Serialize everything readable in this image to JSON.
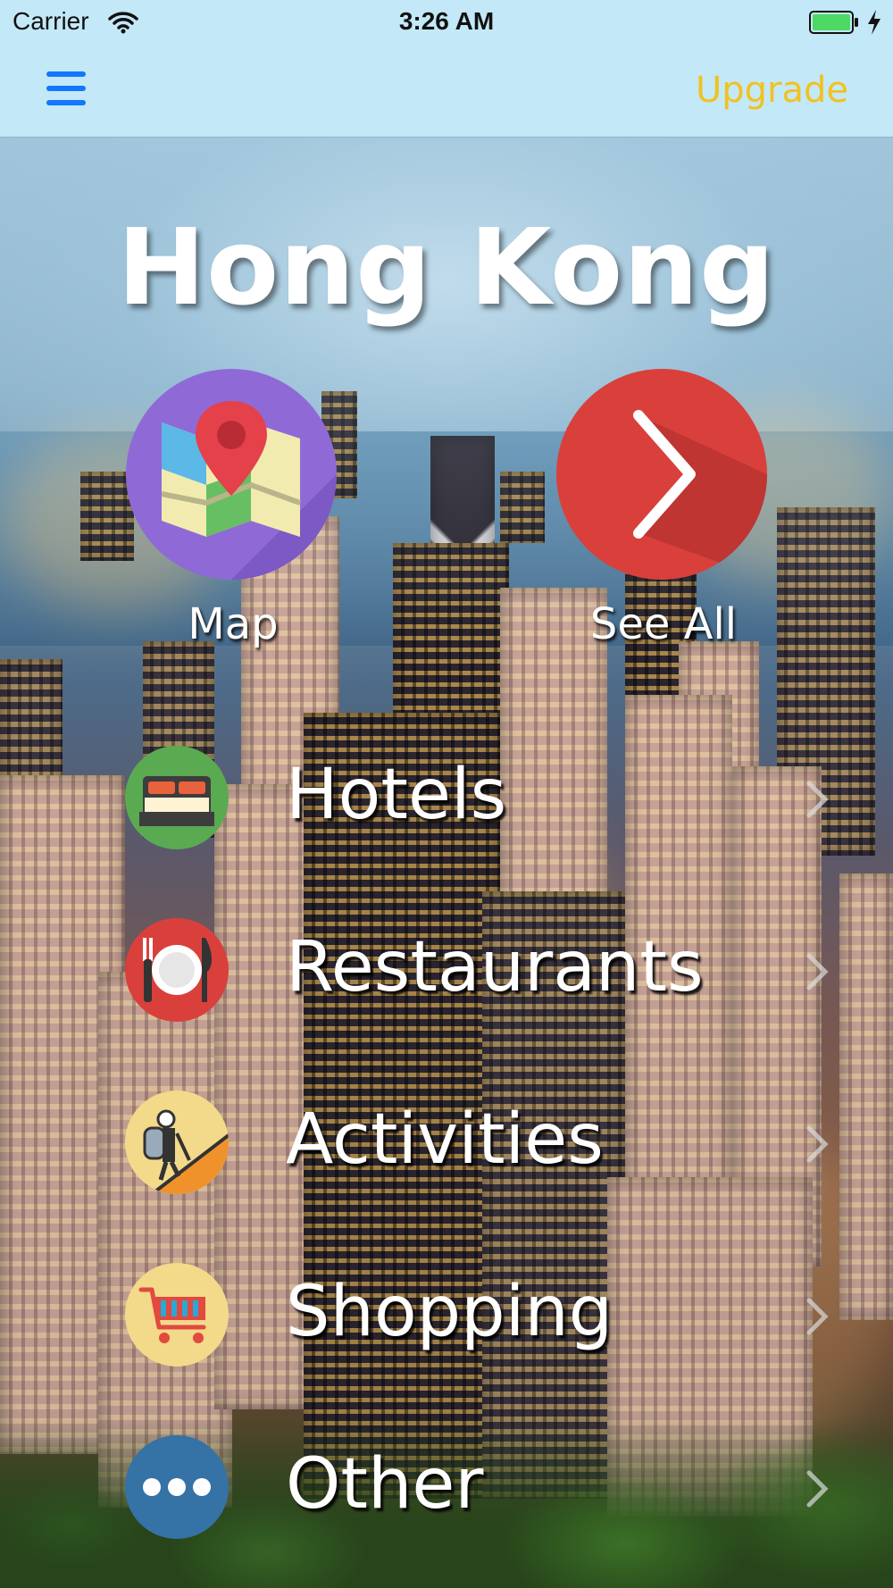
{
  "status_bar": {
    "carrier": "Carrier",
    "time": "3:26 AM",
    "wifi_icon": "wifi-icon",
    "battery_icon": "battery-charging-icon"
  },
  "nav_bar": {
    "menu_icon": "hamburger-menu-icon",
    "upgrade_label": "Upgrade",
    "accent_color": "#1476ff",
    "upgrade_color": "#f1c21e"
  },
  "main": {
    "title": "Hong Kong",
    "quick_actions": [
      {
        "label": "Map",
        "icon": "map-pin-icon",
        "color": "#8f6ad6"
      },
      {
        "label": "See All",
        "icon": "chevron-right-icon",
        "color": "#d9403c"
      }
    ],
    "categories": [
      {
        "label": "Hotels",
        "icon": "bed-icon",
        "color": "#5aaa52"
      },
      {
        "label": "Restaurants",
        "icon": "plate-cutlery-icon",
        "color": "#d9403c"
      },
      {
        "label": "Activities",
        "icon": "hiker-mountain-icon",
        "color": "#f3d98a"
      },
      {
        "label": "Shopping",
        "icon": "shopping-cart-icon",
        "color": "#f3d98a"
      },
      {
        "label": "Other",
        "icon": "more-dots-icon",
        "color": "#3572a6"
      }
    ]
  }
}
